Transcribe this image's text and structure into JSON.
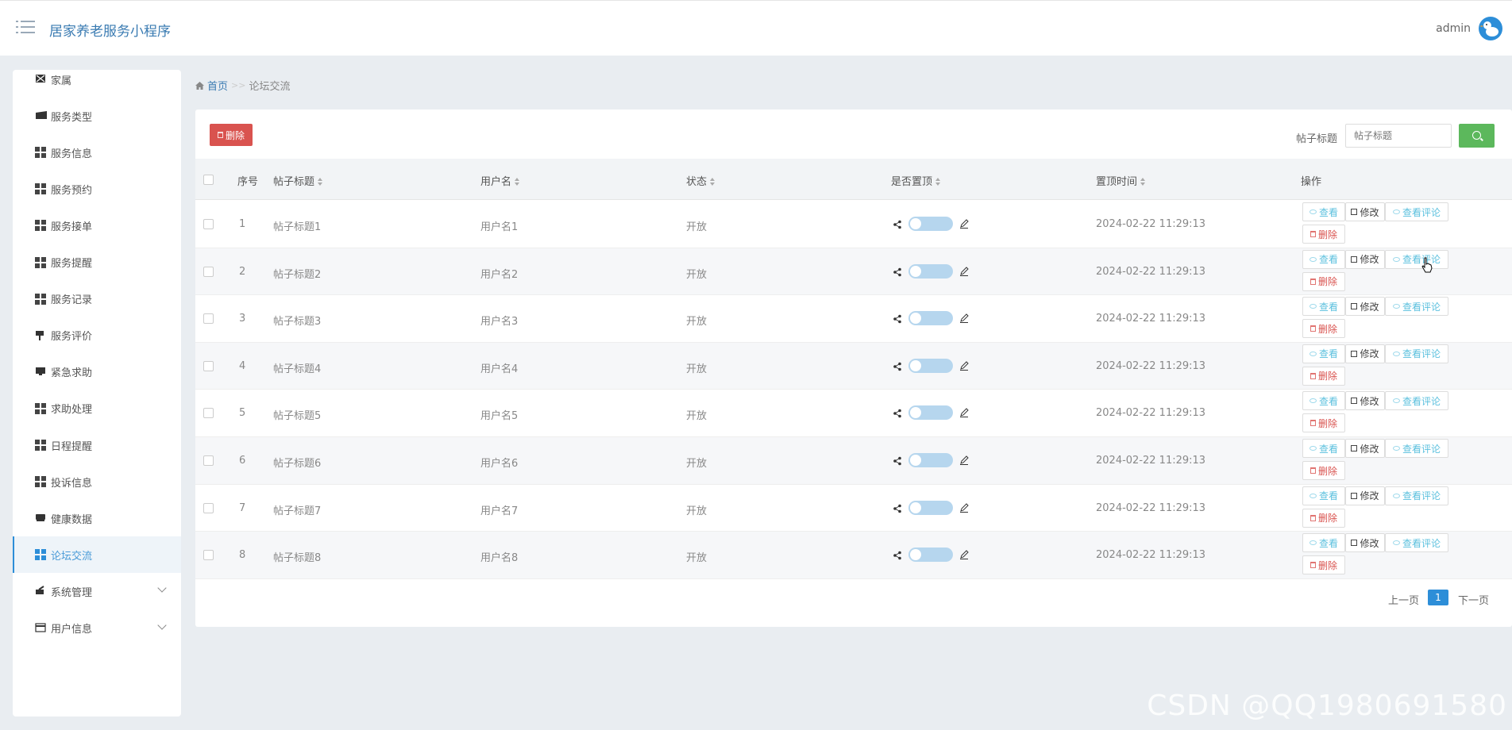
{
  "header": {
    "app_title": "居家养老服务小程序",
    "user_name": "admin"
  },
  "sidebar": {
    "items": [
      {
        "label": "家属",
        "icon": "family-icon"
      },
      {
        "label": "服务类型",
        "icon": "ticket-icon"
      },
      {
        "label": "服务信息",
        "icon": "grid-icon"
      },
      {
        "label": "服务预约",
        "icon": "grid-icon"
      },
      {
        "label": "服务接单",
        "icon": "grid-icon"
      },
      {
        "label": "服务提醒",
        "icon": "grid-icon"
      },
      {
        "label": "服务记录",
        "icon": "grid-icon"
      },
      {
        "label": "服务评价",
        "icon": "pin-icon"
      },
      {
        "label": "紧急求助",
        "icon": "monitor-icon"
      },
      {
        "label": "求助处理",
        "icon": "grid-icon"
      },
      {
        "label": "日程提醒",
        "icon": "grid-icon"
      },
      {
        "label": "投诉信息",
        "icon": "grid-icon"
      },
      {
        "label": "健康数据",
        "icon": "keyboard-icon"
      },
      {
        "label": "论坛交流",
        "icon": "grid-icon",
        "active": true
      },
      {
        "label": "系统管理",
        "icon": "settings-icon",
        "expandable": true
      },
      {
        "label": "用户信息",
        "icon": "card-icon",
        "expandable": true
      }
    ]
  },
  "breadcrumb": {
    "home": "首页",
    "separator": ">>",
    "current": "论坛交流"
  },
  "toolbar": {
    "delete_label": "删除",
    "search_label": "帖子标题",
    "search_placeholder": "帖子标题"
  },
  "table": {
    "headers": {
      "index": "序号",
      "title": "帖子标题",
      "username": "用户名",
      "status": "状态",
      "pinned": "是否置顶",
      "pin_time": "置顶时间",
      "actions": "操作"
    },
    "rows": [
      {
        "index": "1",
        "title": "帖子标题1",
        "username": "用户名1",
        "status": "开放",
        "pin_time": "2024-02-22 11:29:13"
      },
      {
        "index": "2",
        "title": "帖子标题2",
        "username": "用户名2",
        "status": "开放",
        "pin_time": "2024-02-22 11:29:13"
      },
      {
        "index": "3",
        "title": "帖子标题3",
        "username": "用户名3",
        "status": "开放",
        "pin_time": "2024-02-22 11:29:13"
      },
      {
        "index": "4",
        "title": "帖子标题4",
        "username": "用户名4",
        "status": "开放",
        "pin_time": "2024-02-22 11:29:13"
      },
      {
        "index": "5",
        "title": "帖子标题5",
        "username": "用户名5",
        "status": "开放",
        "pin_time": "2024-02-22 11:29:13"
      },
      {
        "index": "6",
        "title": "帖子标题6",
        "username": "用户名6",
        "status": "开放",
        "pin_time": "2024-02-22 11:29:13"
      },
      {
        "index": "7",
        "title": "帖子标题7",
        "username": "用户名7",
        "status": "开放",
        "pin_time": "2024-02-22 11:29:13"
      },
      {
        "index": "8",
        "title": "帖子标题8",
        "username": "用户名8",
        "status": "开放",
        "pin_time": "2024-02-22 11:29:13"
      }
    ],
    "actions": {
      "view": "查看",
      "edit": "修改",
      "view_comments": "查看评论",
      "delete": "删除"
    }
  },
  "pagination": {
    "prev": "上一页",
    "current": "1",
    "next": "下一页"
  },
  "watermark": "CSDN @QQ1980691580",
  "colors": {
    "primary": "#2d8ed8",
    "danger": "#d9534f",
    "success": "#5cb85c",
    "info": "#5bc0de"
  }
}
